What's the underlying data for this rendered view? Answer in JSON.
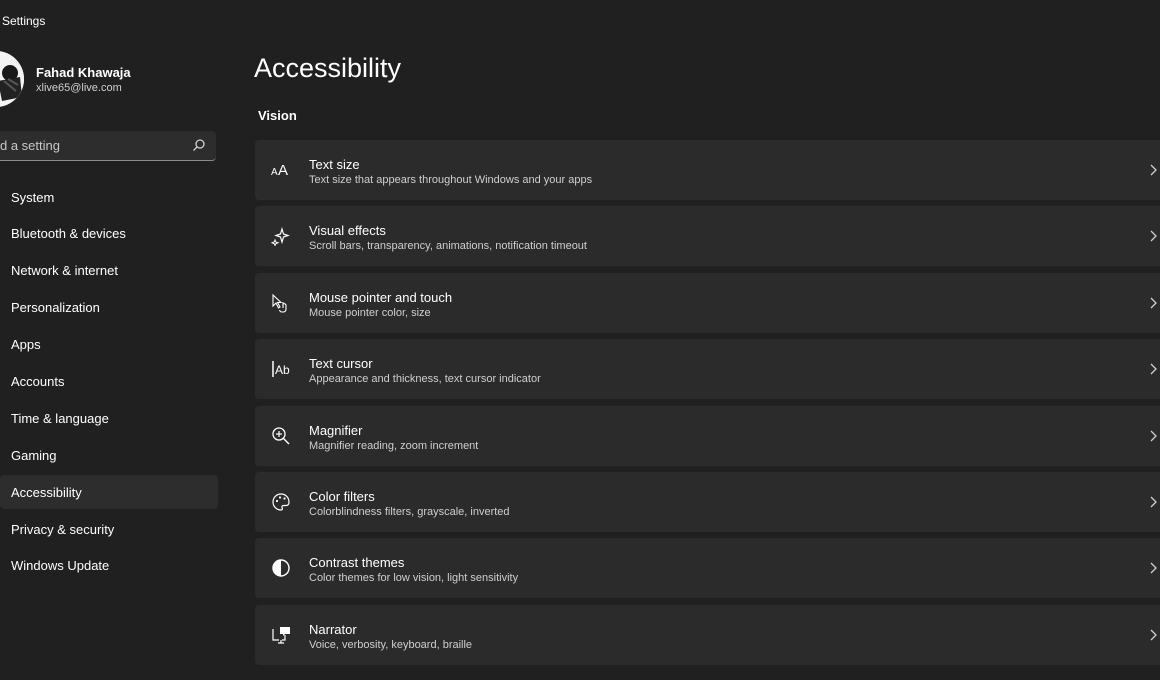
{
  "window": {
    "title": "Settings"
  },
  "profile": {
    "name": "Fahad Khawaja",
    "email": "xlive65@live.com"
  },
  "search": {
    "placeholder": "d a setting"
  },
  "sidebar": {
    "items": [
      {
        "label": "System"
      },
      {
        "label": "Bluetooth & devices"
      },
      {
        "label": "Network & internet"
      },
      {
        "label": "Personalization"
      },
      {
        "label": "Apps"
      },
      {
        "label": "Accounts"
      },
      {
        "label": "Time & language"
      },
      {
        "label": "Gaming"
      },
      {
        "label": "Accessibility",
        "active": true
      },
      {
        "label": "Privacy & security"
      },
      {
        "label": "Windows Update"
      }
    ]
  },
  "main": {
    "title": "Accessibility",
    "section": "Vision",
    "cards": [
      {
        "title": "Text size",
        "subtitle": "Text size that appears throughout Windows and your apps",
        "icon": "text-size-icon"
      },
      {
        "title": "Visual effects",
        "subtitle": "Scroll bars, transparency, animations, notification timeout",
        "icon": "sparkle-icon"
      },
      {
        "title": "Mouse pointer and touch",
        "subtitle": "Mouse pointer color, size",
        "icon": "pointer-touch-icon"
      },
      {
        "title": "Text cursor",
        "subtitle": "Appearance and thickness, text cursor indicator",
        "icon": "text-cursor-icon"
      },
      {
        "title": "Magnifier",
        "subtitle": "Magnifier reading, zoom increment",
        "icon": "magnifier-icon"
      },
      {
        "title": "Color filters",
        "subtitle": "Colorblindness filters, grayscale, inverted",
        "icon": "palette-icon"
      },
      {
        "title": "Contrast themes",
        "subtitle": "Color themes for low vision, light sensitivity",
        "icon": "contrast-icon"
      },
      {
        "title": "Narrator",
        "subtitle": "Voice, verbosity, keyboard, braille",
        "icon": "narrator-icon"
      }
    ]
  },
  "colors": {
    "background": "#202020",
    "card": "#2b2b2b",
    "active_nav": "#2d2d2d"
  }
}
